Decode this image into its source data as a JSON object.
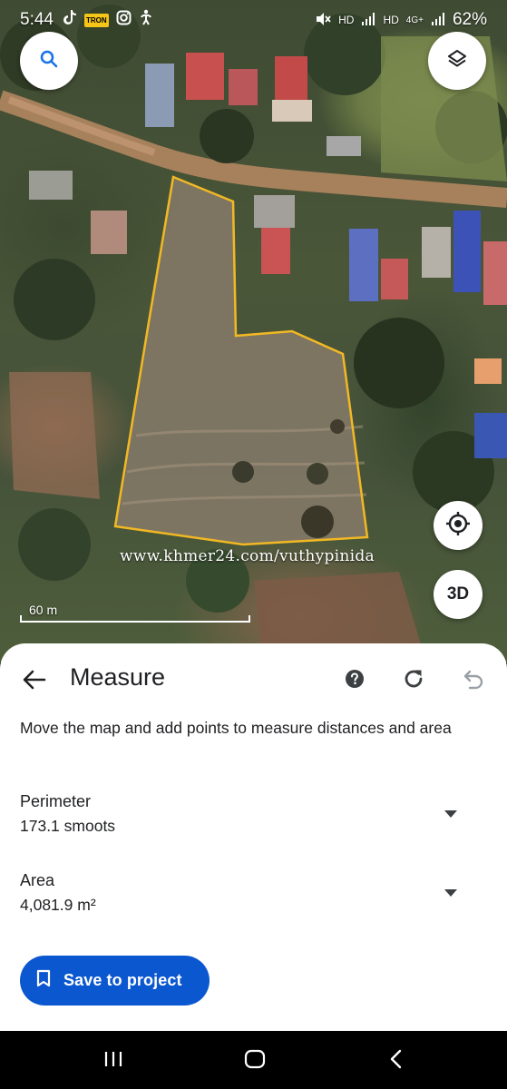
{
  "status_bar": {
    "time": "5:44",
    "left_icons": [
      "tiktok-icon",
      "tron-badge",
      "instagram-icon",
      "accessibility-icon"
    ],
    "tron_badge": "TRON",
    "right_icons": [
      "mute-icon",
      "signal-icon",
      "signal-icon"
    ],
    "hd1": "HD",
    "hd2": "HD",
    "network": "4G+",
    "battery": "62%"
  },
  "map": {
    "search_icon": "search-icon",
    "layers_icon": "layers-icon",
    "location_icon": "my-location-icon",
    "btn_3d": "3D",
    "watermark": "www.khmer24.com/vuthypinida",
    "scale_label": "60 m",
    "colors": {
      "polygon_outline": "#f2b824"
    }
  },
  "measure": {
    "title": "Measure",
    "instructions": "Move the map and add points to measure distances and area",
    "perimeter": {
      "label": "Perimeter",
      "value": "173.1 smoots"
    },
    "area": {
      "label": "Area",
      "value": "4,081.9 m²"
    },
    "save_label": "Save to project",
    "colors": {
      "primary": "#0b57d0",
      "text": "#202124"
    }
  },
  "nav": {
    "recents_icon": "recents-icon",
    "home_icon": "home-icon",
    "back_icon": "back-icon"
  }
}
